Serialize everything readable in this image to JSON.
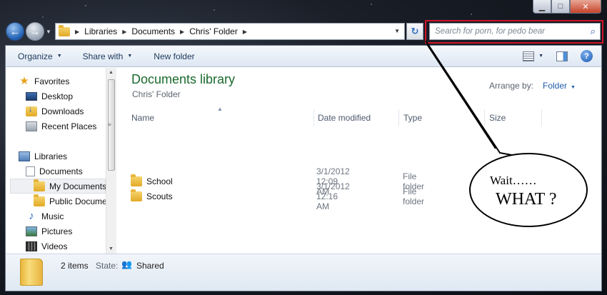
{
  "window": {
    "caption": {
      "minimize": "▁",
      "maximize": "□",
      "close": "✕"
    }
  },
  "address": {
    "crumbs": [
      "Libraries",
      "Documents",
      "Chris' Folder"
    ],
    "refresh_icon": "refresh-icon"
  },
  "search": {
    "placeholder": "Search for porn, for pedo bear",
    "highlight_color": "#d0142a"
  },
  "toolbar": {
    "organize": "Organize",
    "share_with": "Share with",
    "new_folder": "New folder",
    "help": "?"
  },
  "navpane": {
    "favorites": "Favorites",
    "desktop": "Desktop",
    "downloads": "Downloads",
    "recent": "Recent Places",
    "libraries": "Libraries",
    "documents": "Documents",
    "my_documents": "My Documents",
    "public_documents": "Public Docume",
    "music": "Music",
    "pictures": "Pictures",
    "videos": "Videos"
  },
  "content": {
    "title": "Documents library",
    "subtitle": "Chris' Folder",
    "arrange_label": "Arrange by:",
    "arrange_value": "Folder",
    "columns": {
      "name": "Name",
      "date": "Date modified",
      "type": "Type",
      "size": "Size"
    },
    "rows": [
      {
        "name": "School",
        "date": "3/1/2012 12:09 AM",
        "type": "File folder"
      },
      {
        "name": "Scouts",
        "date": "3/1/2012 12:16 AM",
        "type": "File folder"
      }
    ]
  },
  "details": {
    "count": "2 items",
    "state_label": "State:",
    "state": "Shared"
  },
  "annotation": {
    "line1": "Wait……",
    "line2": "WHAT ?"
  }
}
